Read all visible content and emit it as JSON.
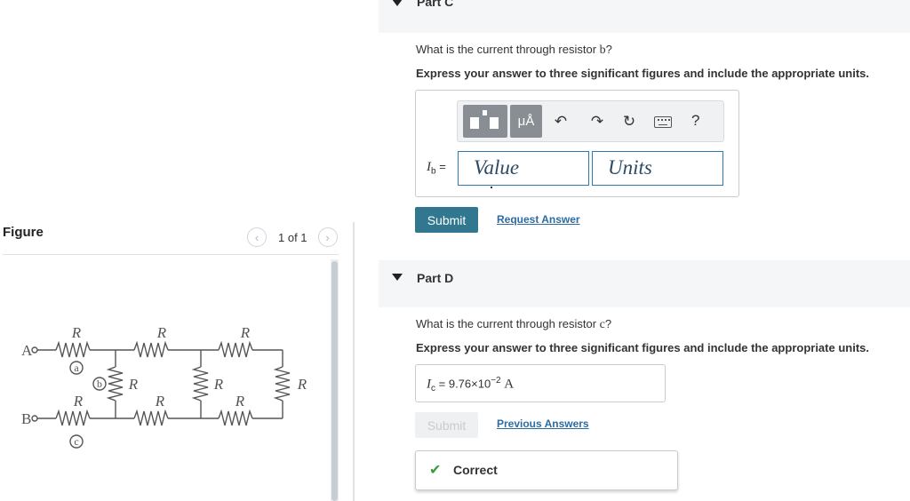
{
  "figure_panel": {
    "title": "Figure",
    "pager": {
      "prev_icon": "chevron-left-icon",
      "next_icon": "chevron-right-icon",
      "count": "1 of 1"
    },
    "circuit": {
      "resistor_label": "R",
      "terminals": [
        "A",
        "B"
      ],
      "node_labels": [
        "a",
        "b",
        "c"
      ]
    }
  },
  "part_c": {
    "title": "Part C",
    "question": {
      "text": "What is the current through resistor ",
      "resistor": "b",
      "suffix": "?"
    },
    "instruction": "Express your answer to three significant figures and include the appropriate units.",
    "toolbar": {
      "templates_icon": "templates-icon",
      "units_label": "μÅ",
      "undo_icon": "undo-icon",
      "redo_icon": "redo-icon",
      "reset_icon": "reset-icon",
      "keyboard_icon": "keyboard-icon",
      "help_label": "?"
    },
    "variable": {
      "symbol": "I",
      "subscript": "b",
      "equals": "="
    },
    "value_placeholder": "Value",
    "units_placeholder": "Units",
    "submit_label": "Submit",
    "request_answer_label": "Request Answer"
  },
  "part_d": {
    "title": "Part D",
    "question": {
      "text": "What is the current through resistor ",
      "resistor": "c",
      "suffix": "?"
    },
    "instruction": "Express your answer to three significant figures and include the appropriate units.",
    "answer": {
      "symbol": "I",
      "subscript": "c",
      "equals": "=",
      "mantissa": "9.76×10",
      "exponent": "−2",
      "unit": "A"
    },
    "submit_label": "Submit",
    "previous_answers_label": "Previous Answers",
    "feedback": {
      "icon": "checkmark-icon",
      "text": "Correct",
      "color": "#3a9a3a"
    }
  },
  "colors": {
    "link": "#2b6ca3",
    "submit": "#31778f",
    "field_border": "#2e7ab0"
  }
}
